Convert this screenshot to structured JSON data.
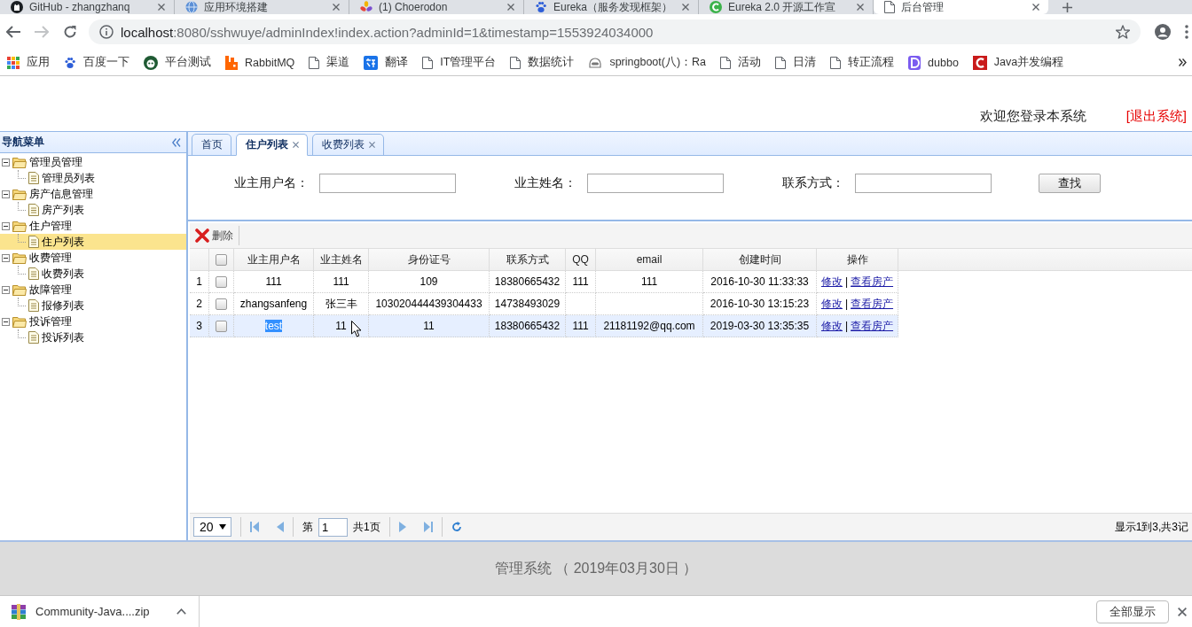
{
  "browser": {
    "tabs": [
      {
        "title": "GitHub - zhangzhanq",
        "kind": "github",
        "selected": false
      },
      {
        "title": "应用环境搭建",
        "kind": "globe",
        "selected": false
      },
      {
        "title": "(1) Choerodon",
        "kind": "flower",
        "selected": false
      },
      {
        "title": "Eureka（服务发现框架）",
        "kind": "paw",
        "selected": false
      },
      {
        "title": "Eureka 2.0 开源工作宣",
        "kind": "leaf",
        "selected": false
      },
      {
        "title": "后台管理",
        "kind": "page",
        "selected": true
      }
    ],
    "nav": {
      "forward_disabled": true
    },
    "address": {
      "host": "localhost",
      "rest": ":8080/sshwuye/adminIndex!index.action?adminId=1&timestamp=1553924034000"
    },
    "bookmarks": [
      {
        "label": "应用",
        "kind": "apps"
      },
      {
        "label": "百度一下",
        "kind": "paw"
      },
      {
        "label": "平台测试",
        "kind": "panda"
      },
      {
        "label": "RabbitMQ",
        "kind": "rabbit"
      },
      {
        "label": "渠道",
        "kind": "page"
      },
      {
        "label": "翻译",
        "kind": "translate"
      },
      {
        "label": "IT管理平台",
        "kind": "page"
      },
      {
        "label": "数据统计",
        "kind": "page"
      },
      {
        "label": "springboot(八)：Ra",
        "kind": "robot"
      },
      {
        "label": "活动",
        "kind": "page"
      },
      {
        "label": "日清",
        "kind": "page"
      },
      {
        "label": "转正流程",
        "kind": "page"
      },
      {
        "label": "dubbo",
        "kind": "dubbo"
      },
      {
        "label": "Java并发编程",
        "kind": "csdn"
      }
    ]
  },
  "header": {
    "welcome": "欢迎您登录本系统",
    "logout": "[退出系统]"
  },
  "sidebar": {
    "title": "导航菜单",
    "tree": [
      {
        "label": "管理员管理",
        "expanded": true,
        "selected": false,
        "children": [
          {
            "label": "管理员列表",
            "selected": false
          }
        ]
      },
      {
        "label": "房产信息管理",
        "expanded": true,
        "selected": false,
        "children": [
          {
            "label": "房产列表",
            "selected": false
          }
        ]
      },
      {
        "label": "住户管理",
        "expanded": true,
        "selected": false,
        "children": [
          {
            "label": "住户列表",
            "selected": true
          }
        ]
      },
      {
        "label": "收费管理",
        "expanded": true,
        "selected": false,
        "children": [
          {
            "label": "收费列表",
            "selected": false
          }
        ]
      },
      {
        "label": "故障管理",
        "expanded": true,
        "selected": false,
        "children": [
          {
            "label": "报修列表",
            "selected": false
          }
        ]
      },
      {
        "label": "投诉管理",
        "expanded": true,
        "selected": false,
        "children": [
          {
            "label": "投诉列表",
            "selected": false
          }
        ]
      }
    ]
  },
  "tabs": [
    {
      "label": "首页",
      "closable": false,
      "selected": false
    },
    {
      "label": "住户列表",
      "closable": true,
      "selected": true
    },
    {
      "label": "收费列表",
      "closable": true,
      "selected": false
    }
  ],
  "search": {
    "fields": [
      {
        "label": "业主用户名："
      },
      {
        "label": "业主姓名："
      },
      {
        "label": "联系方式："
      }
    ],
    "button": "查找"
  },
  "toolbar": {
    "delete": "删除"
  },
  "table": {
    "columns": [
      "业主用户名",
      "业主姓名",
      "身份证号",
      "联系方式",
      "QQ",
      "email",
      "创建时间",
      "操作"
    ],
    "header_checked": false,
    "rows": [
      {
        "number": "1",
        "checked": false,
        "selected": false,
        "username": "111",
        "username_highlighted": false,
        "name": "111",
        "id_number": "109",
        "phone": "18380665432",
        "qq": "111",
        "email": "111",
        "created": "2016-10-30 11:33:33",
        "actions": [
          "修改",
          "查看房产"
        ],
        "separator": "|"
      },
      {
        "number": "2",
        "checked": false,
        "selected": false,
        "username": "zhangsanfeng",
        "username_highlighted": false,
        "name": "张三丰",
        "id_number": "103020444439304433",
        "phone": "14738493029",
        "created": "2016-10-30 13:15:23",
        "actions": [
          "修改",
          "查看房产"
        ],
        "separator": "|"
      },
      {
        "number": "3",
        "checked": false,
        "selected": true,
        "username": "test",
        "username_highlighted": true,
        "name": "11",
        "id_number": "11",
        "phone": "18380665432",
        "qq": "111",
        "email": "21181192@qq.com",
        "created": "2019-03-30 13:35:35",
        "actions": [
          "修改",
          "查看房产"
        ],
        "separator": "|"
      }
    ]
  },
  "pager": {
    "page_size": "20",
    "page_prefix": "第",
    "page": "1",
    "page_total": "共1页",
    "summary": "显示1到3,共3记"
  },
  "footer": "管理系统 （ 2019年03月30日 ）",
  "downloads": {
    "file": "Community-Java....zip",
    "show_all": "全部显示"
  }
}
